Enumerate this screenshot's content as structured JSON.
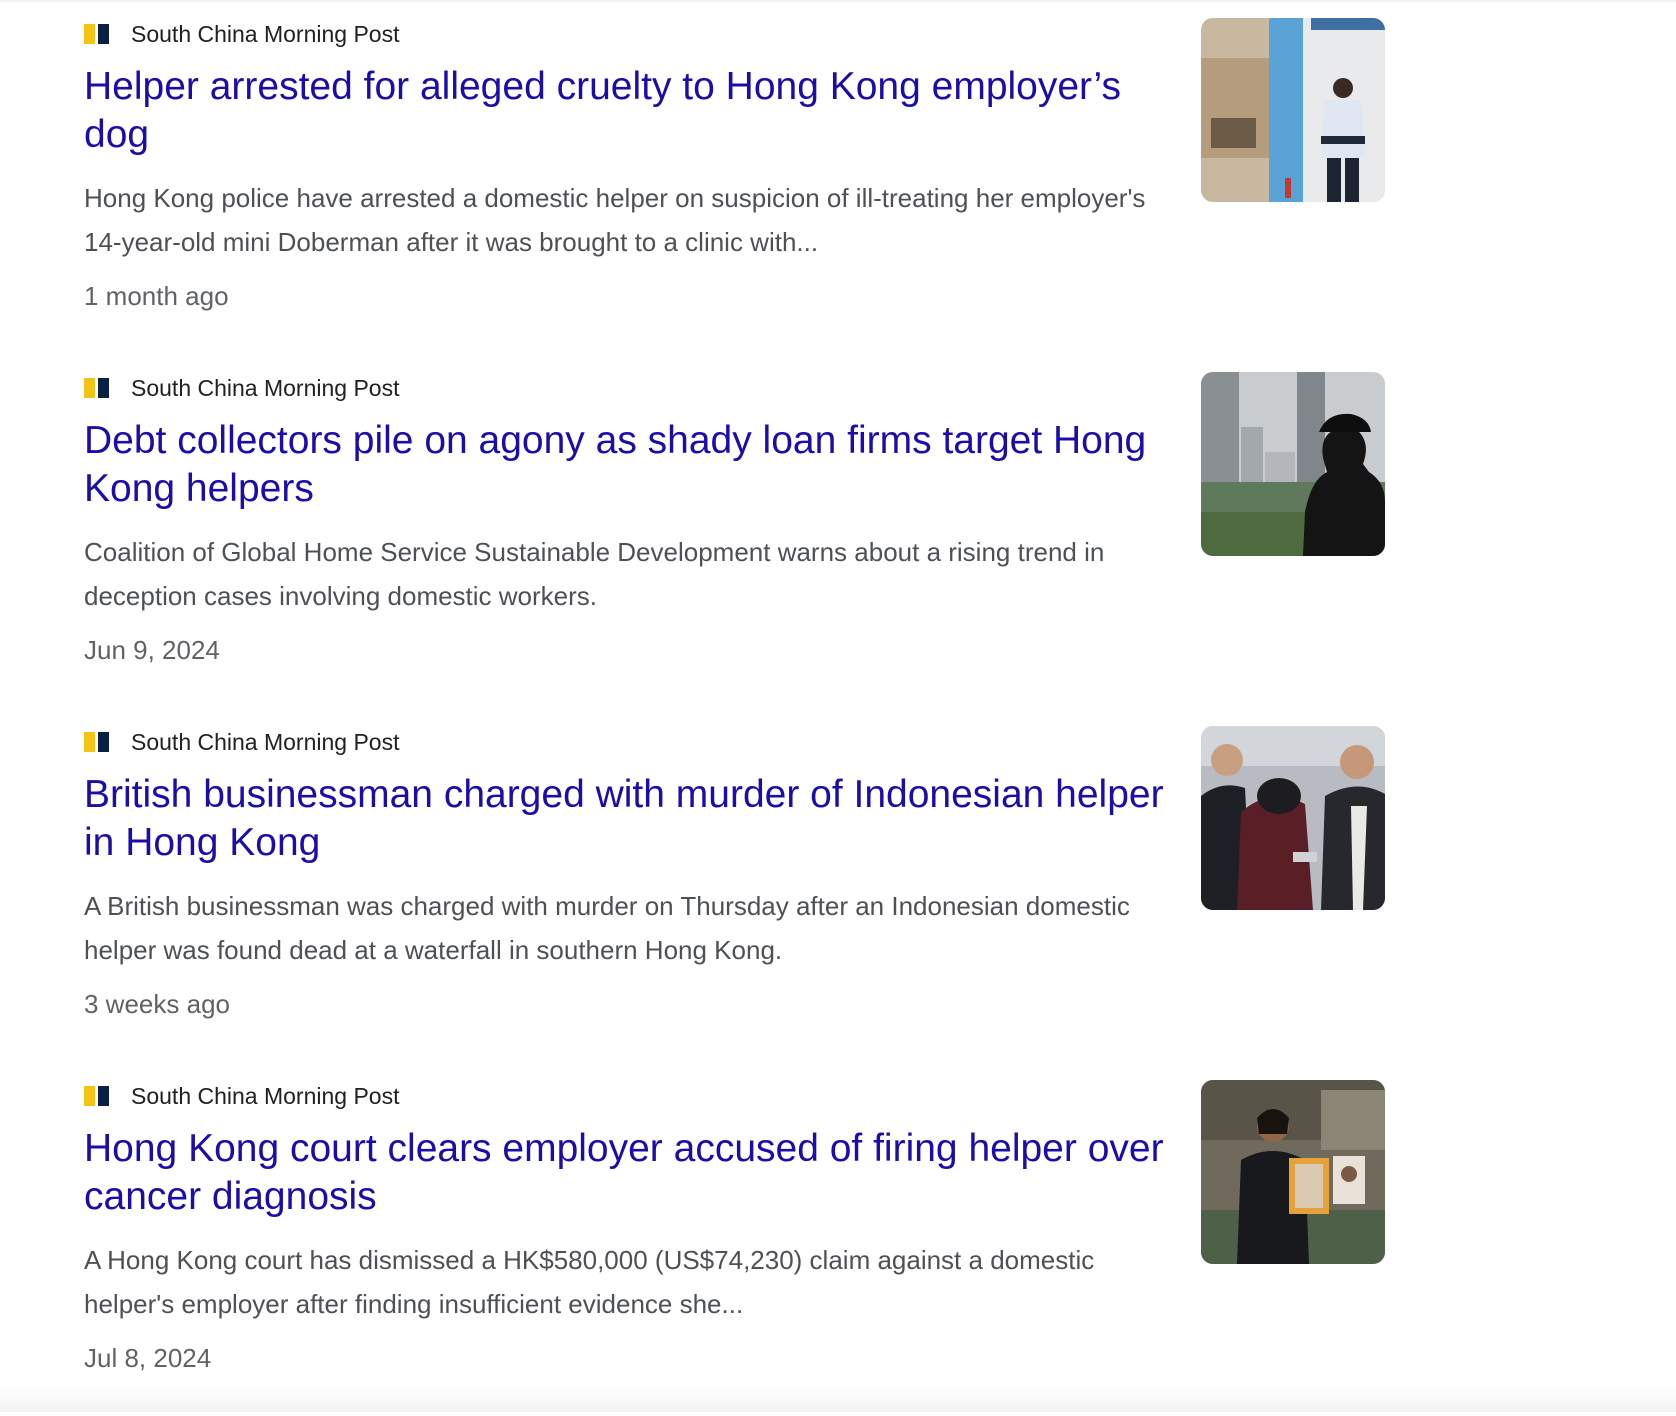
{
  "results": [
    {
      "source": "South China Morning Post",
      "title": "Helper arrested for alleged cruelty to Hong Kong employer’s dog",
      "snippet": "Hong Kong police have arrested a domestic helper on suspicion of ill-treating her employer's 14-year-old mini Doberman after it was brought to a clinic with...",
      "date": "1 month ago",
      "thumbnail_icon": "police-officer-storefront-image"
    },
    {
      "source": "South China Morning Post",
      "title": "Debt collectors pile on agony as shady loan firms target Hong Kong helpers",
      "snippet": "Coalition of Global Home Service Sustainable Development warns about a rising trend in deception cases involving domestic workers.",
      "date": "Jun 9, 2024",
      "thumbnail_icon": "silhouette-skyline-image"
    },
    {
      "source": "South China Morning Post",
      "title": "British businessman charged with murder of Indonesian helper in Hong Kong",
      "snippet": "A British businessman was charged with murder on Thursday after an Indonesian domestic helper was found dead at a waterfall in southern Hong Kong.",
      "date": "3 weeks ago",
      "thumbnail_icon": "suspect-escorted-image"
    },
    {
      "source": "South China Morning Post",
      "title": "Hong Kong court clears employer accused of firing helper over cancer diagnosis",
      "snippet": "A Hong Kong court has dismissed a HK$580,000 (US$74,230) claim against a domestic helper's employer after finding insufficient evidence she...",
      "date": "Jul 8, 2024",
      "thumbnail_icon": "woman-holding-photo-image"
    }
  ],
  "colors": {
    "link": "#1a0dab",
    "snippet": "#4d5156",
    "meta": "#5f6368",
    "favicon_yellow": "#f3c316",
    "favicon_navy": "#0a1f44"
  }
}
